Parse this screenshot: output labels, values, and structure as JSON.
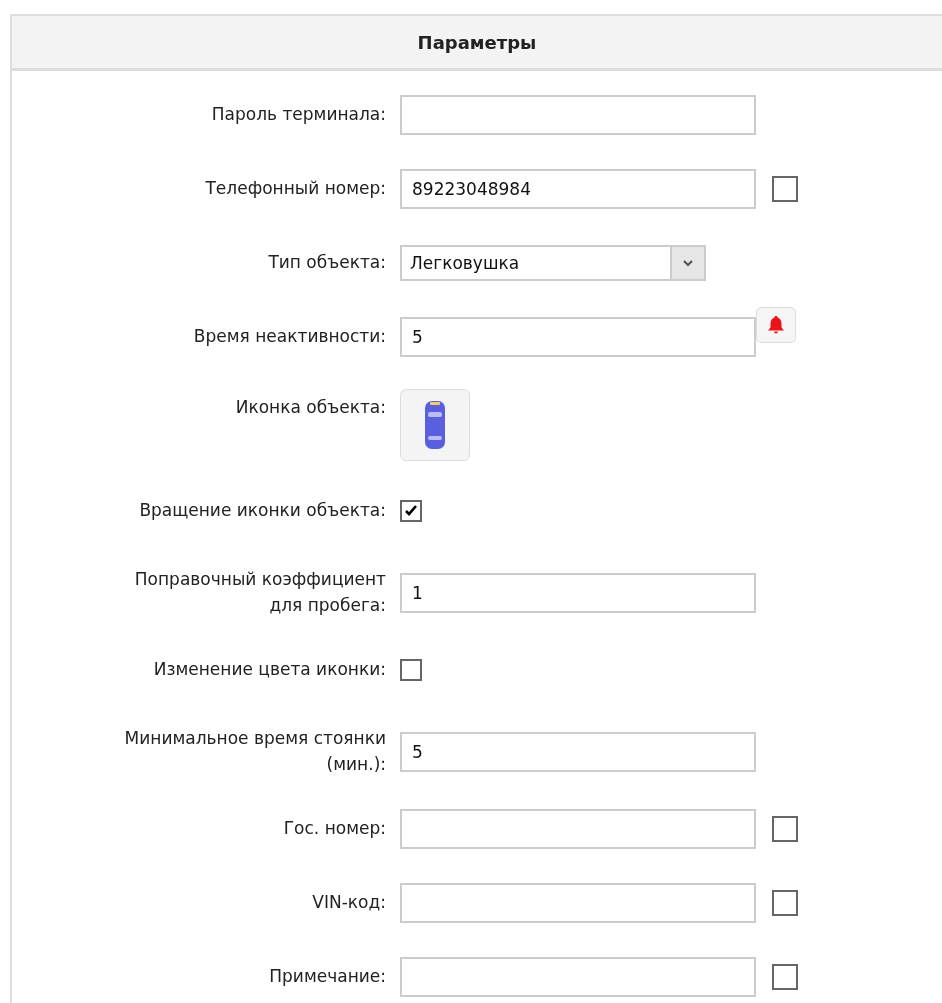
{
  "panel": {
    "title": "Параметры"
  },
  "rows": [
    {
      "kind": "text",
      "label": "Пароль терминала:",
      "value": ""
    },
    {
      "kind": "text",
      "label": "Телефонный номер:",
      "value": "89223048984",
      "checked": false
    },
    {
      "kind": "select",
      "label": "Тип объекта:",
      "value": "Легковушка"
    },
    {
      "kind": "alarm",
      "label": "Время неактивности:",
      "value": "5"
    },
    {
      "kind": "icon",
      "label": "Иконка объекта:"
    },
    {
      "kind": "checkbox",
      "label": "Вращение иконки объекта:",
      "checked": true
    },
    {
      "kind": "text",
      "label": "Поправочный коэффициент для пробега:",
      "value": "1"
    },
    {
      "kind": "checkbox",
      "label": "Изменение цвета иконки:",
      "checked": false
    },
    {
      "kind": "text",
      "label": "Минимальное время стоянки (мин.):",
      "value": "5"
    },
    {
      "kind": "text",
      "label": "Гос. номер:",
      "value": "",
      "checked": false
    },
    {
      "kind": "text",
      "label": "VIN-код:",
      "value": "",
      "checked": false
    },
    {
      "kind": "text",
      "label": "Примечание:",
      "value": "",
      "checked": false
    }
  ]
}
